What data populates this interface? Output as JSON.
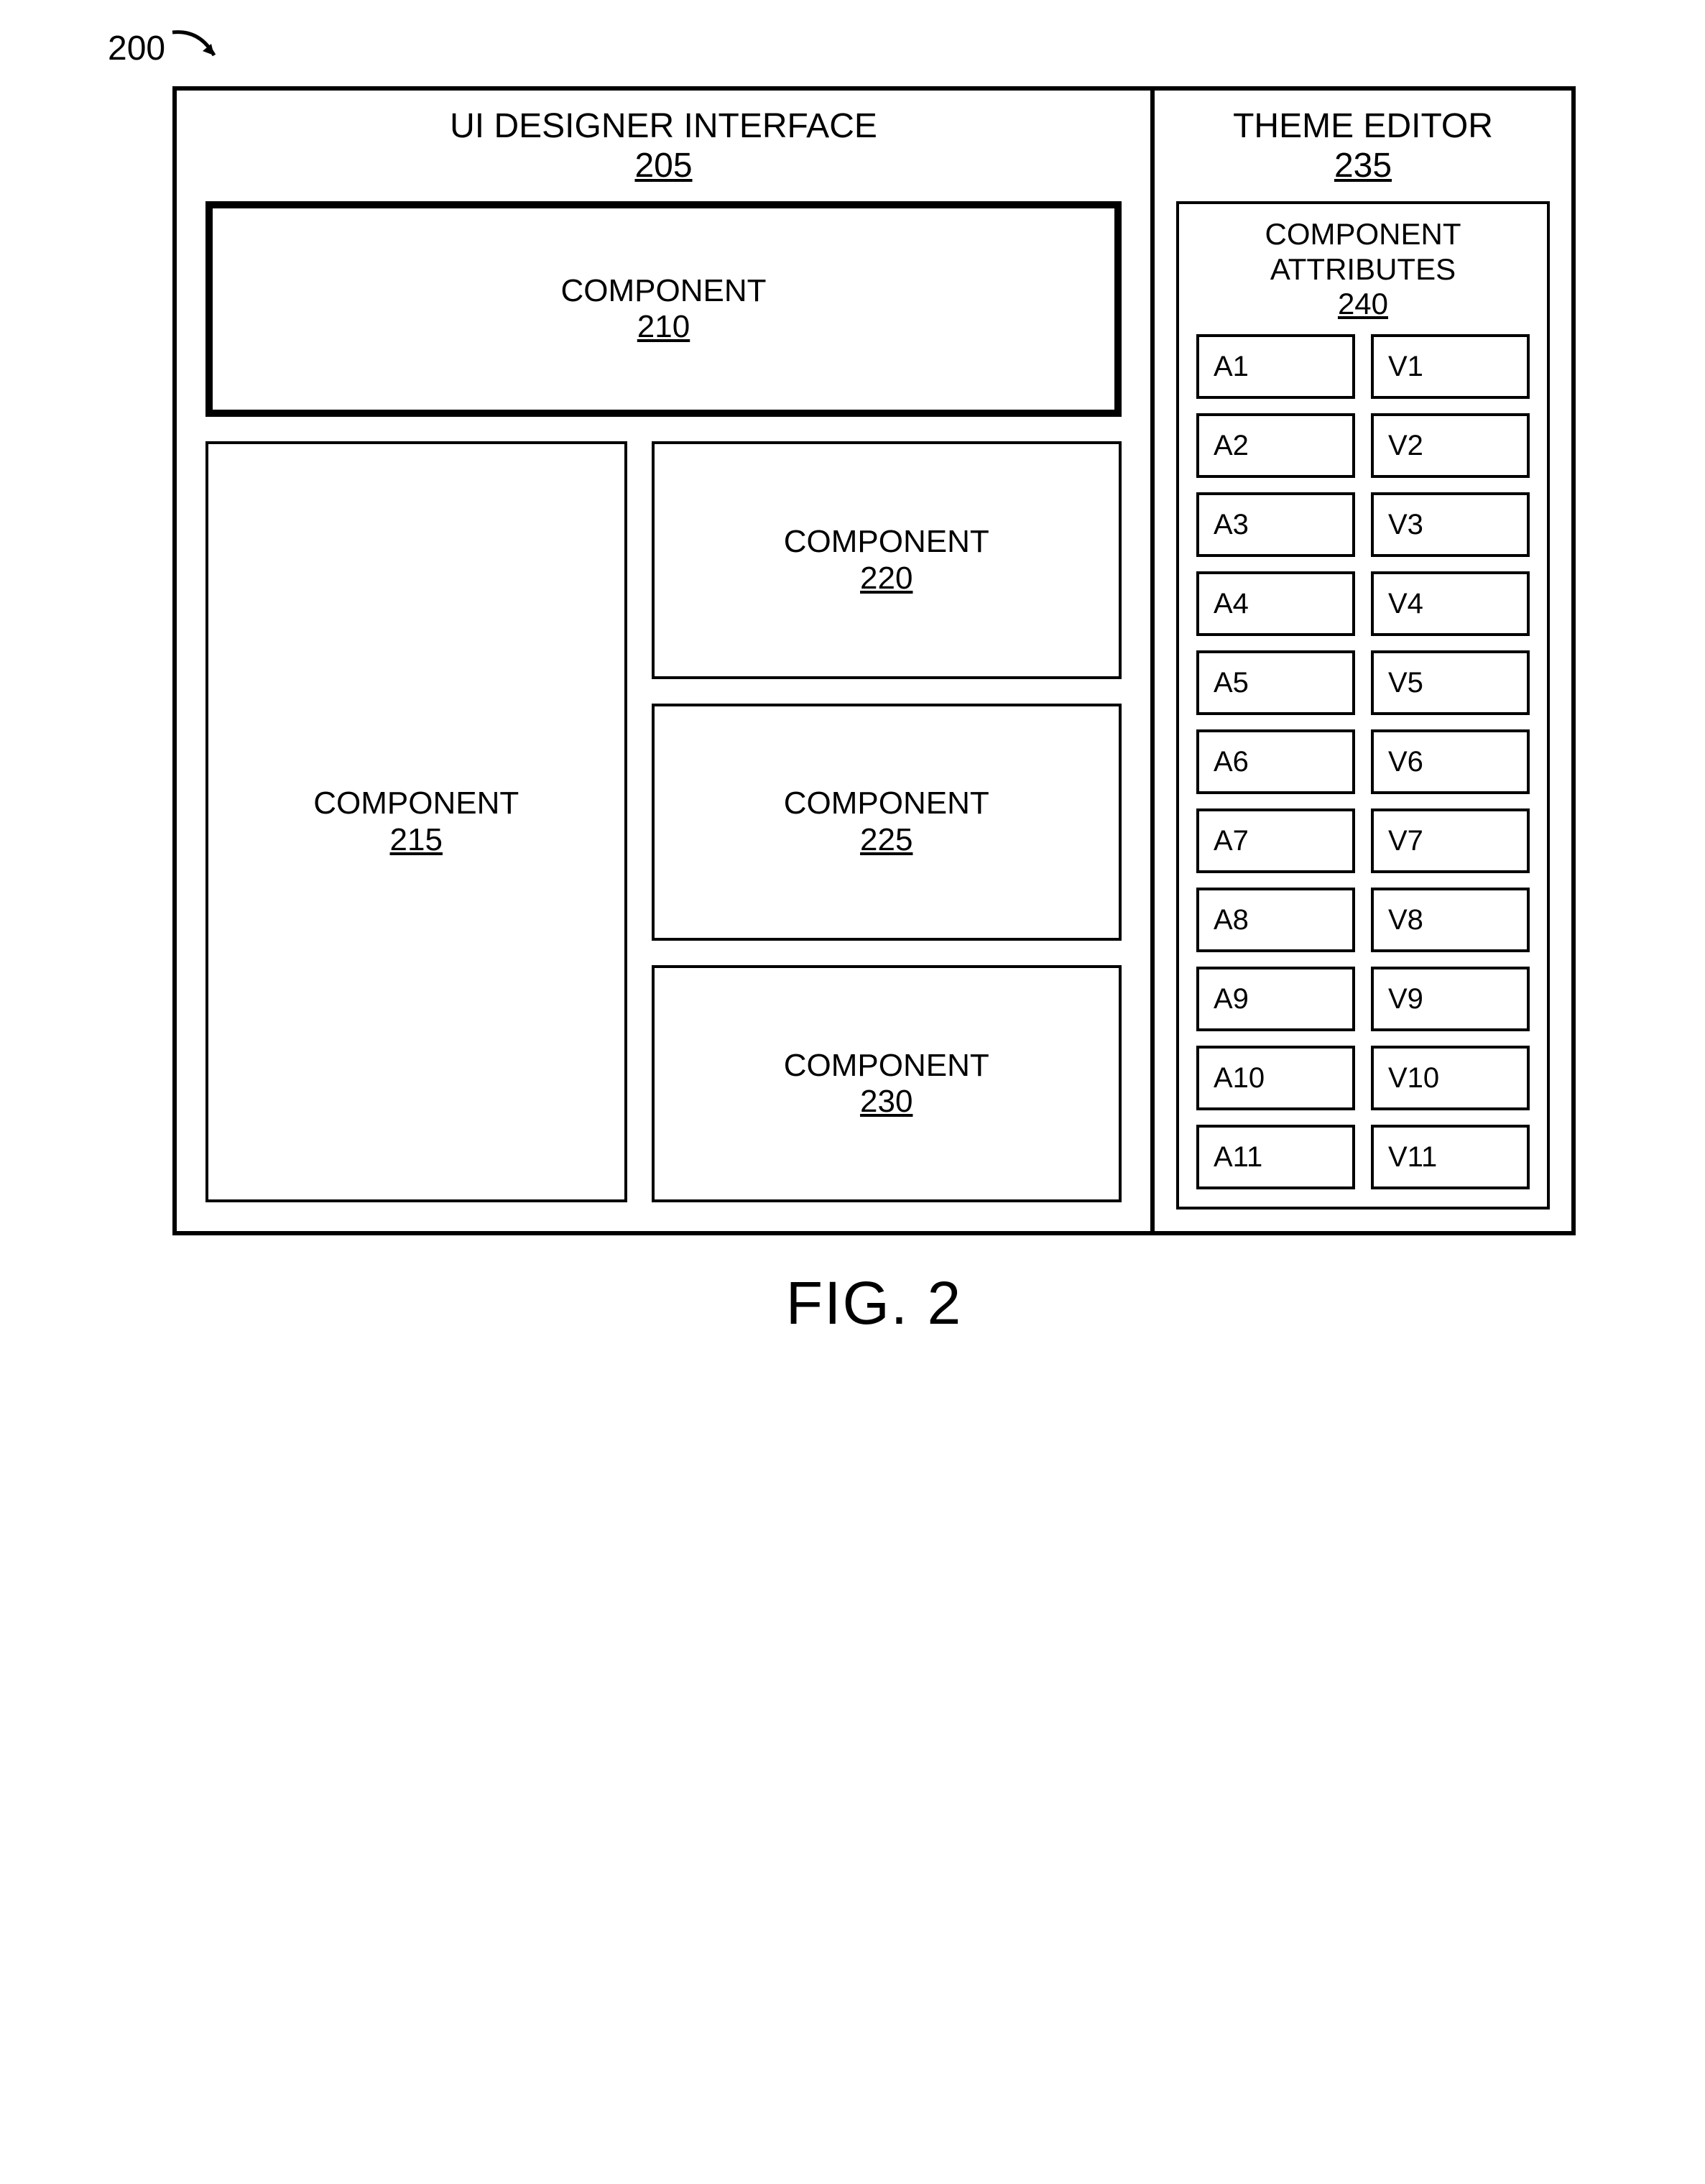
{
  "reference_marker": "200",
  "figure_caption": "FIG. 2",
  "left_panel": {
    "title": "UI DESIGNER INTERFACE",
    "ref": "205",
    "components": {
      "top": {
        "label": "COMPONENT",
        "ref": "210"
      },
      "left": {
        "label": "COMPONENT",
        "ref": "215"
      },
      "r1": {
        "label": "COMPONENT",
        "ref": "220"
      },
      "r2": {
        "label": "COMPONENT",
        "ref": "225"
      },
      "r3": {
        "label": "COMPONENT",
        "ref": "230"
      }
    }
  },
  "right_panel": {
    "title": "THEME EDITOR",
    "ref": "235",
    "attributes_box": {
      "title": "COMPONENT ATTRIBUTES",
      "ref": "240",
      "rows": [
        {
          "attr": "A1",
          "val": "V1"
        },
        {
          "attr": "A2",
          "val": "V2"
        },
        {
          "attr": "A3",
          "val": "V3"
        },
        {
          "attr": "A4",
          "val": "V4"
        },
        {
          "attr": "A5",
          "val": "V5"
        },
        {
          "attr": "A6",
          "val": "V6"
        },
        {
          "attr": "A7",
          "val": "V7"
        },
        {
          "attr": "A8",
          "val": "V8"
        },
        {
          "attr": "A9",
          "val": "V9"
        },
        {
          "attr": "A10",
          "val": "V10"
        },
        {
          "attr": "A11",
          "val": "V11"
        }
      ]
    }
  }
}
